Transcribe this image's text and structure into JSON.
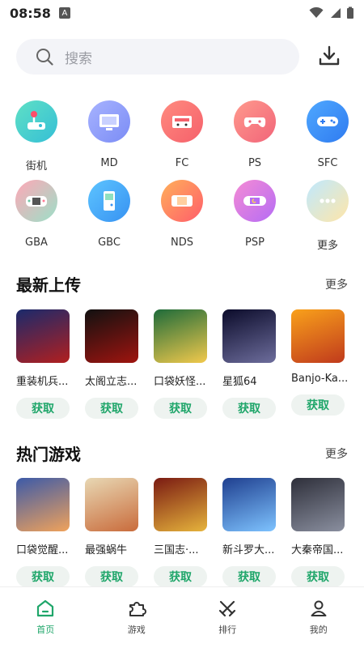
{
  "status_bar": {
    "time": "08:58",
    "badge": "A"
  },
  "search": {
    "placeholder": "搜索"
  },
  "categories": [
    {
      "label": "街机",
      "icon": "arcade-joystick-icon",
      "colors": [
        "#5fe0c5",
        "#35bfd6"
      ]
    },
    {
      "label": "MD",
      "icon": "md-monitor-icon",
      "colors": [
        "#a7b3ff",
        "#7b8cf5"
      ]
    },
    {
      "label": "FC",
      "icon": "fc-cartridge-icon",
      "colors": [
        "#ff8b7f",
        "#f5606b"
      ]
    },
    {
      "label": "PS",
      "icon": "ps-gamepad-icon",
      "colors": [
        "#ff9a8d",
        "#f16479"
      ]
    },
    {
      "label": "SFC",
      "icon": "sfc-controller-icon",
      "colors": [
        "#4fa8ff",
        "#2f7bf0"
      ]
    },
    {
      "label": "GBA",
      "icon": "gba-handheld-icon",
      "colors": [
        "#ffa7b6",
        "#9be0c8"
      ]
    },
    {
      "label": "GBC",
      "icon": "gbc-handheld-icon",
      "colors": [
        "#5dc4ff",
        "#3792f2"
      ]
    },
    {
      "label": "NDS",
      "icon": "nds-handheld-icon",
      "colors": [
        "#ffb05a",
        "#ff5d6b"
      ]
    },
    {
      "label": "PSP",
      "icon": "psp-handheld-icon",
      "colors": [
        "#f58bd4",
        "#b56cf5"
      ]
    },
    {
      "label": "更多",
      "icon": "more-dots-icon",
      "colors": [
        "#bfe9ff",
        "#ffe6a8"
      ]
    }
  ],
  "latest": {
    "title": "最新上传",
    "more": "更多",
    "games": [
      {
        "name": "重装机兵...",
        "action": "获取",
        "cover_colors": [
          "#1a2a6c",
          "#b21f1f"
        ]
      },
      {
        "name": "太阁立志...",
        "action": "获取",
        "cover_colors": [
          "#111111",
          "#a0140f"
        ]
      },
      {
        "name": "口袋妖怪...",
        "action": "获取",
        "cover_colors": [
          "#1e6b3a",
          "#f2c94c"
        ]
      },
      {
        "name": "星狐64",
        "action": "获取",
        "cover_colors": [
          "#0b0b2a",
          "#6d6d9c"
        ]
      },
      {
        "name": "Banjo-Ka...",
        "action": "获取",
        "cover_colors": [
          "#f9a11b",
          "#c03a1c"
        ]
      }
    ]
  },
  "hot": {
    "title": "热门游戏",
    "more": "更多",
    "games": [
      {
        "name": "口袋觉醒...",
        "action": "获取",
        "cover_colors": [
          "#3c5aa8",
          "#f0a25b"
        ]
      },
      {
        "name": "最强蜗牛",
        "action": "获取",
        "cover_colors": [
          "#e8d8b4",
          "#c96b3b"
        ]
      },
      {
        "name": "三国志·...",
        "action": "获取",
        "cover_colors": [
          "#7a1a12",
          "#e6b43c"
        ]
      },
      {
        "name": "新斗罗大...",
        "action": "获取",
        "cover_colors": [
          "#1f3f8f",
          "#7ec3ff"
        ]
      },
      {
        "name": "大秦帝国...",
        "action": "获取",
        "cover_colors": [
          "#2e2f3a",
          "#8a8f9f"
        ]
      }
    ]
  },
  "bottom_nav": [
    {
      "label": "首页",
      "icon": "home-icon",
      "active": true
    },
    {
      "label": "游戏",
      "icon": "puzzle-icon",
      "active": false
    },
    {
      "label": "排行",
      "icon": "crossed-swords-icon",
      "active": false
    },
    {
      "label": "我的",
      "icon": "user-icon",
      "active": false
    }
  ],
  "colors": {
    "accent": "#1fa66a",
    "search_bg": "#f3f4f8",
    "button_bg": "#eef3f0"
  }
}
